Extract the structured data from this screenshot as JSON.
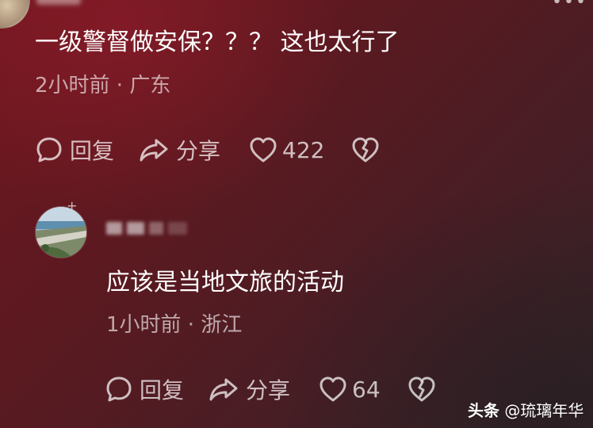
{
  "comment": {
    "text": "一级警督做安保？？？ 这也太行了",
    "meta": "2小时前 · 广东",
    "actions": {
      "reply": "回复",
      "share": "分享",
      "likes": "422"
    }
  },
  "reply": {
    "text": "应该是当地文旅的活动",
    "meta": "1小时前 · 浙江",
    "actions": {
      "reply": "回复",
      "share": "分享",
      "likes": "64"
    }
  },
  "watermark": {
    "brand": "头条",
    "handle": "@琉璃年华"
  },
  "icons": {
    "reply": "chat-bubble-icon",
    "share": "share-arrow-icon",
    "like": "heart-icon",
    "dislike": "broken-heart-icon",
    "more": "more-dots-icon"
  }
}
